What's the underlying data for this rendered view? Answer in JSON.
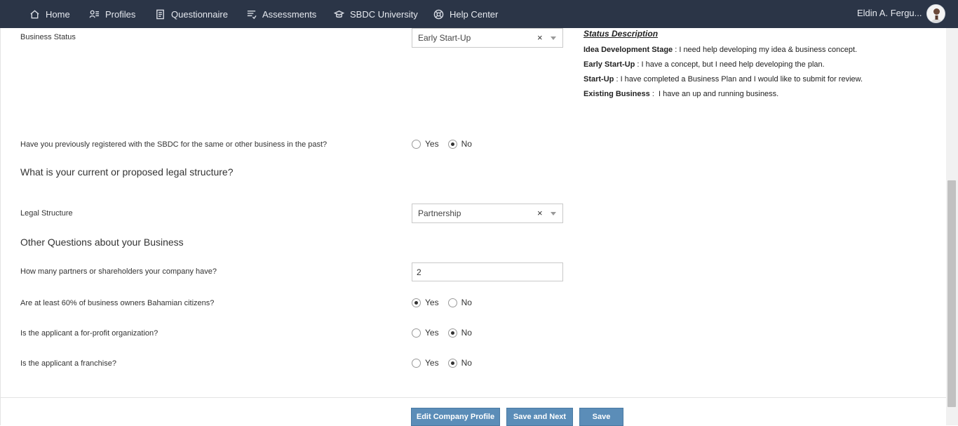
{
  "nav": {
    "items": [
      {
        "label": "Home",
        "icon": "home-icon"
      },
      {
        "label": "Profiles",
        "icon": "profiles-icon"
      },
      {
        "label": "Questionnaire",
        "icon": "questionnaire-icon"
      },
      {
        "label": "Assessments",
        "icon": "assessments-icon"
      },
      {
        "label": "SBDC University",
        "icon": "graduation-cap-icon"
      },
      {
        "label": "Help Center",
        "icon": "help-center-icon"
      }
    ],
    "user_name": "Eldin A. Fergu..."
  },
  "form": {
    "business_status": {
      "label": "Business Status",
      "value": "Early Start-Up",
      "clear": "×"
    },
    "status_description": {
      "title": "Status Description",
      "items": [
        {
          "term": "Idea Development Stage",
          "sep": " : ",
          "text": "I need help developing my idea & business concept."
        },
        {
          "term": "Early Start-Up",
          "sep": " : ",
          "text": "I have a concept, but I need help developing the plan."
        },
        {
          "term": "Start-Up",
          "sep": " : ",
          "text": "I have completed a Business Plan and I would like to submit for review."
        },
        {
          "term": "Existing Business",
          "sep": " :  ",
          "text": "I have an up and running business."
        }
      ]
    },
    "previously_registered": {
      "label": "Have you previously registered with the SBDC for the same or other business in the past?",
      "yes": "Yes",
      "no": "No",
      "selected": "No"
    },
    "legal_section_title": "What is your current or proposed legal structure?",
    "legal_structure": {
      "label": "Legal Structure",
      "value": "Partnership",
      "clear": "×"
    },
    "other_section_title": "Other Questions about your Business",
    "partners": {
      "label": "How many partners or shareholders your company have?",
      "value": "2"
    },
    "bahamian": {
      "label": "Are at least 60% of business owners Bahamian citizens?",
      "yes": "Yes",
      "no": "No",
      "selected": "Yes"
    },
    "for_profit": {
      "label": "Is the applicant a for-profit organization?",
      "yes": "Yes",
      "no": "No",
      "selected": "No"
    },
    "franchise": {
      "label": "Is the applicant a franchise?",
      "yes": "Yes",
      "no": "No",
      "selected": "No"
    }
  },
  "buttons": {
    "edit_company_profile": "Edit Company Profile",
    "save_and_next": "Save and Next",
    "save": "Save"
  },
  "colors": {
    "nav_bg": "#2b3547",
    "button_bg": "#5b8db8"
  }
}
